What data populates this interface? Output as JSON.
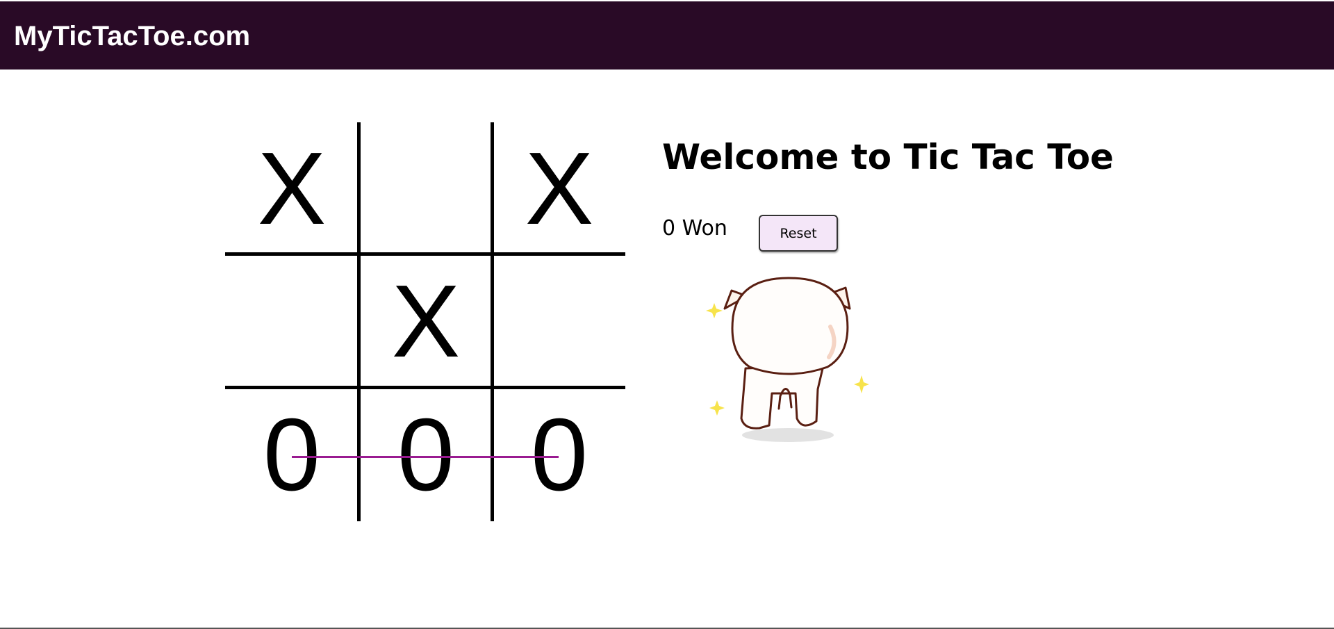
{
  "header": {
    "brand": "MyTicTacToe.com"
  },
  "board": {
    "cells": [
      "X",
      "",
      "X",
      "",
      "X",
      "",
      "0",
      "0",
      "0"
    ],
    "winning_line": {
      "cells": [
        6,
        7,
        8
      ],
      "color": "#9a1b91"
    }
  },
  "panel": {
    "title": "Welcome to Tic Tac Toe",
    "score_label": "0 Won",
    "reset_label": "Reset"
  },
  "illustration": {
    "name": "cat-celebration-image"
  },
  "colors": {
    "navbar_bg": "#290a26",
    "button_bg": "#f4e6f8",
    "sparkle": "#f7e34b"
  }
}
